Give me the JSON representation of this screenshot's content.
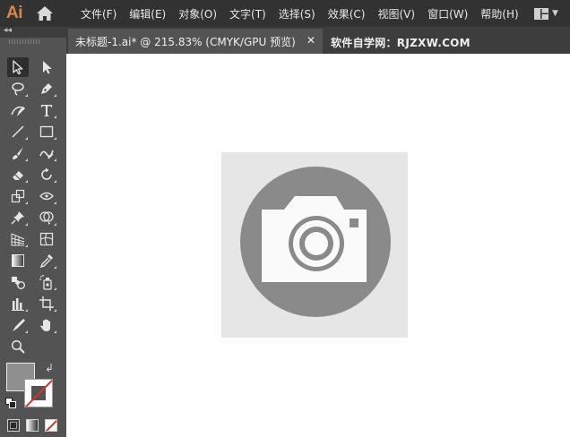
{
  "app": {
    "logo_text": "Ai",
    "brand_color": "#d9884a"
  },
  "menu": {
    "items": [
      {
        "label": "文件(F)"
      },
      {
        "label": "编辑(E)"
      },
      {
        "label": "对象(O)"
      },
      {
        "label": "文字(T)"
      },
      {
        "label": "选择(S)"
      },
      {
        "label": "效果(C)"
      },
      {
        "label": "视图(V)"
      },
      {
        "label": "窗口(W)"
      },
      {
        "label": "帮助(H)"
      }
    ]
  },
  "tabs": {
    "document": "未标题-1.ai* @ 215.83% (CMYK/GPU 预览)",
    "close_glyph": "✕",
    "watermark": "软件自学网：RJZXW.COM"
  },
  "tools": [
    "selection-tool",
    "direct-selection-tool",
    "magic-wand-tool",
    "pen-tool",
    "curvature-tool",
    "type-tool",
    "line-segment-tool",
    "rectangle-tool",
    "paintbrush-tool",
    "shaper-tool",
    "eraser-tool",
    "rotate-tool",
    "scale-tool",
    "width-tool",
    "puppet-warp-tool",
    "shape-builder-tool",
    "perspective-grid-tool",
    "mesh-tool",
    "gradient-tool",
    "eyedropper-tool",
    "blend-tool",
    "symbol-sprayer-tool",
    "column-graph-tool",
    "artboard-tool",
    "slice-tool",
    "hand-tool",
    "zoom-tool"
  ],
  "colors": {
    "fill": "#8f8f8f",
    "stroke": "none",
    "canvas_bg": "#ffffff",
    "artwork_square": "#e6e6e6",
    "artwork_circle": "#8a8a8a",
    "artwork_camera": "#fafafa"
  },
  "artwork": {
    "description_icon": "camera-icon"
  }
}
